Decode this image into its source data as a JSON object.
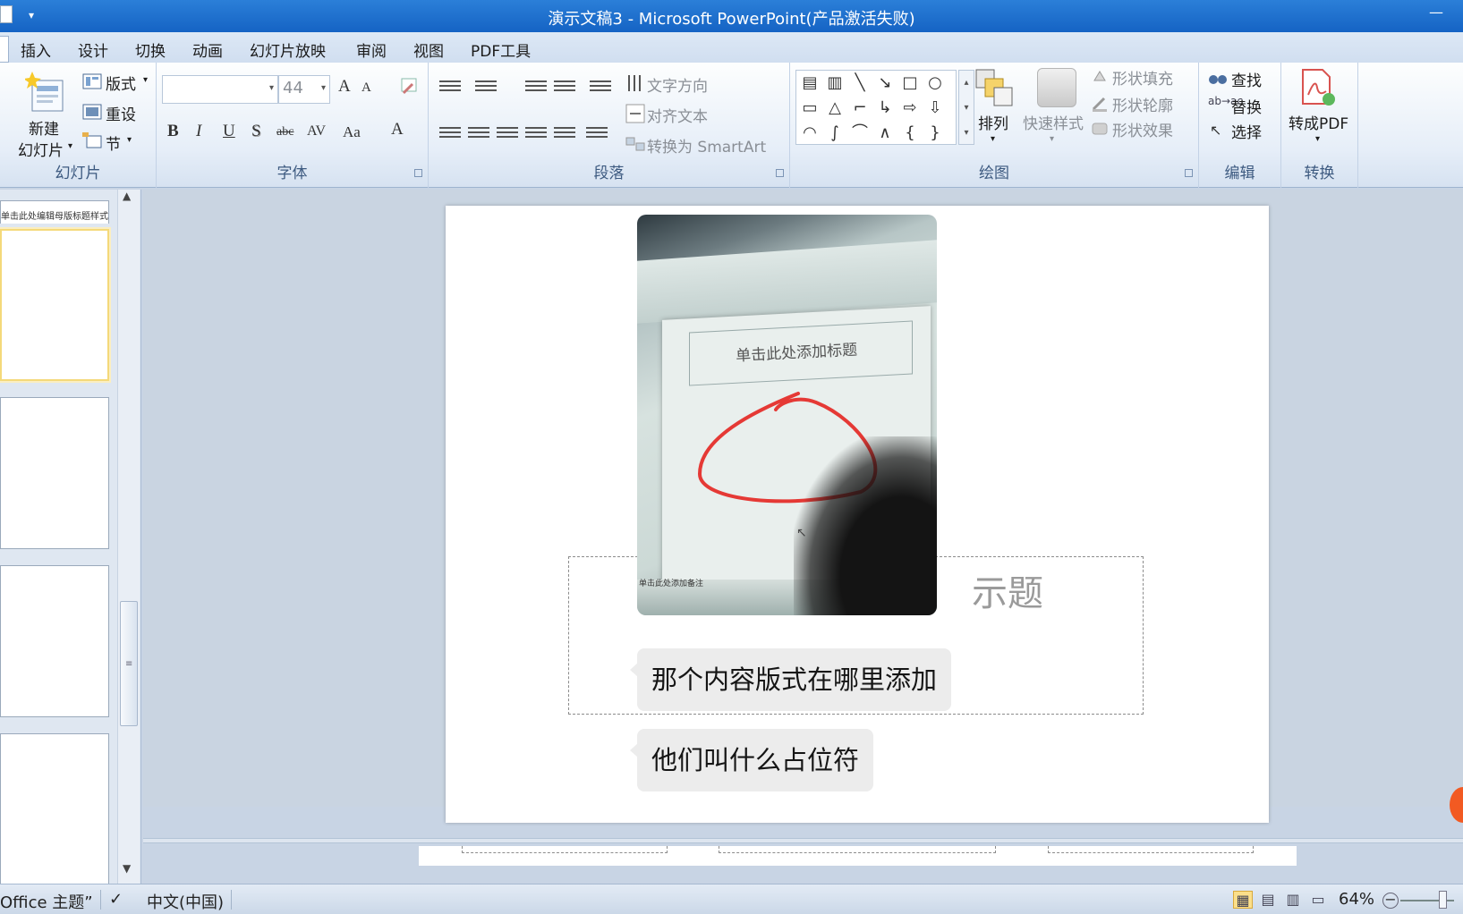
{
  "window": {
    "title": "演示文稿3 - Microsoft PowerPoint(产品激活失败)"
  },
  "tabs": [
    "插入",
    "设计",
    "切换",
    "动画",
    "幻灯片放映",
    "审阅",
    "视图",
    "PDF工具"
  ],
  "ribbon": {
    "slides_group": {
      "label": "幻灯片",
      "new_slide_line1": "新建",
      "new_slide_line2": "幻灯片",
      "layout": "版式",
      "reset": "重设",
      "section": "节"
    },
    "font_group": {
      "label": "字体",
      "font_name": "",
      "font_size": "44",
      "grow": "A",
      "shrink": "A",
      "bold": "B",
      "italic": "I",
      "underline": "U",
      "shadow": "S",
      "strike": "abc",
      "spacing": "AV",
      "case": "Aa",
      "color": "A"
    },
    "paragraph_group": {
      "label": "段落",
      "text_direction": "文字方向",
      "align_text": "对齐文本",
      "convert_smartart": "转换为 SmartArt"
    },
    "drawing_group": {
      "label": "绘图",
      "arrange": "排列",
      "quick_styles": "快速样式",
      "shape_fill": "形状填充",
      "shape_outline": "形状轮廓",
      "shape_effects": "形状效果"
    },
    "editing_group": {
      "label": "编辑",
      "find": "查找",
      "replace": "替换",
      "select": "选择"
    },
    "convert_group": {
      "label": "转换",
      "to_pdf": "转成PDF"
    }
  },
  "thumbnails": {
    "first_text": "单击此处编辑母版标题样式"
  },
  "slide": {
    "placeholder_partial": "示题",
    "photo": {
      "title": "单击此处添加标题",
      "note": "单击此处添加备注"
    },
    "chat": [
      "那个内容版式在哪里添加",
      "他们叫什么占位符"
    ]
  },
  "statusbar": {
    "theme": "Office 主题”",
    "language": "中文(中国)",
    "zoom": "64%"
  },
  "colors": {
    "titlebar": "#1563c4",
    "selected_thumb": "#f4d97a",
    "annotation_circle": "#e53935"
  }
}
